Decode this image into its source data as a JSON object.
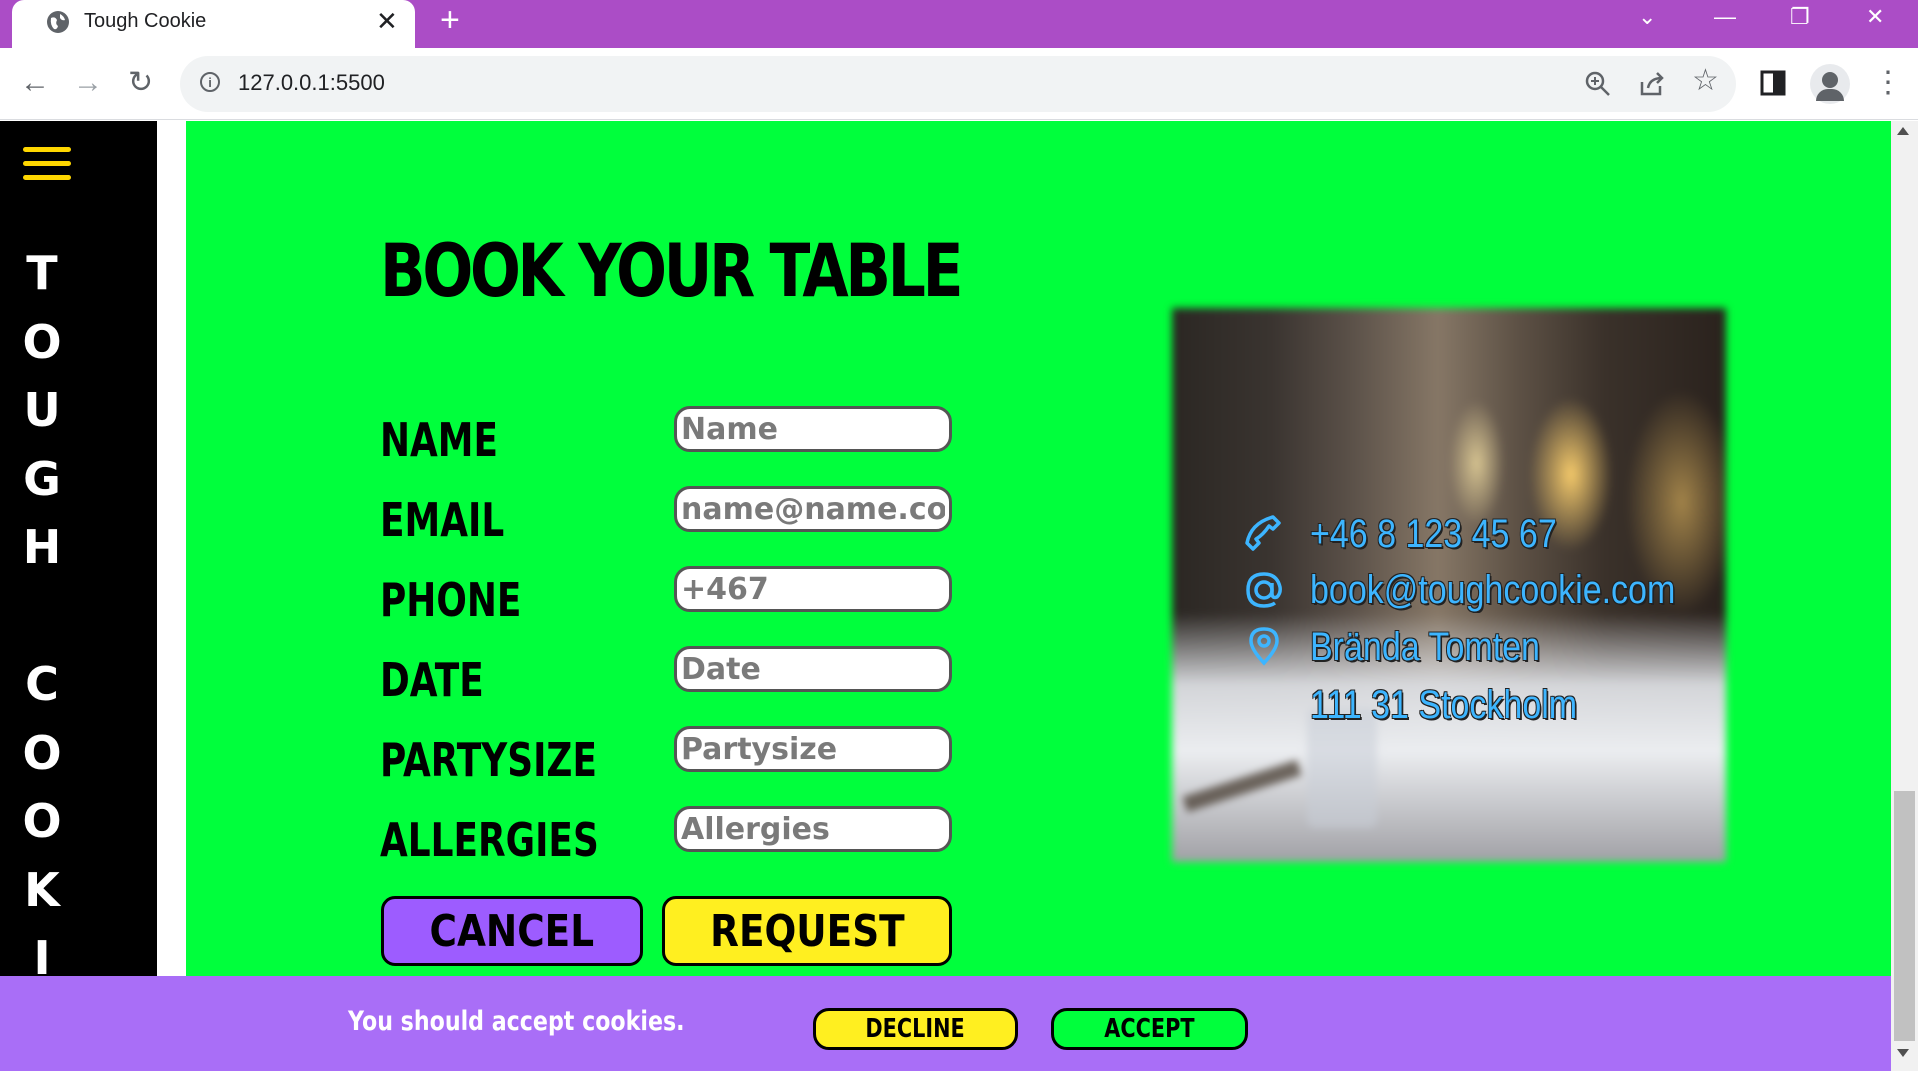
{
  "browser": {
    "tab_title": "Tough Cookie",
    "url": "127.0.0.1:5500",
    "icons": [
      "globe-icon",
      "close-icon",
      "new-tab-icon",
      "back-icon",
      "forward-icon",
      "reload-icon",
      "info-icon",
      "zoom-icon",
      "share-icon",
      "star-icon",
      "side-panel-icon",
      "profile-icon",
      "menu-icon"
    ]
  },
  "sidebar": {
    "menu_icon": "hamburger-icon",
    "brand_letters": [
      "T",
      "O",
      "U",
      "G",
      "H",
      " ",
      "C",
      "O",
      "O",
      "K",
      "I"
    ]
  },
  "booking": {
    "heading": "BOOK YOUR TABLE",
    "fields": [
      {
        "label": "NAME",
        "placeholder": "Name"
      },
      {
        "label": "EMAIL",
        "placeholder": "name@name.com"
      },
      {
        "label": "PHONE",
        "placeholder": "+467"
      },
      {
        "label": "DATE",
        "placeholder": "Date"
      },
      {
        "label": "PARTYSIZE",
        "placeholder": "Partysize"
      },
      {
        "label": "ALLERGIES",
        "placeholder": "Allergies"
      }
    ],
    "cancel_label": "CANCEL",
    "request_label": "REQUEST"
  },
  "contact": {
    "phone": "+46 8 123 45 67",
    "email": "book@toughcookie.com",
    "street": "Brända Tomten",
    "city": "111 31 Stockholm"
  },
  "cookie_banner": {
    "message": "You should accept cookies.",
    "decline_label": "DECLINE",
    "accept_label": "ACCEPT"
  },
  "colors": {
    "tabbar": "#ab4dc6",
    "page_green": "#00ff3c",
    "cancel_purple": "#9d5cff",
    "request_yellow": "#ffef20",
    "cookie_bar": "#a96ef7",
    "contact_blue": "#3db5ff"
  }
}
